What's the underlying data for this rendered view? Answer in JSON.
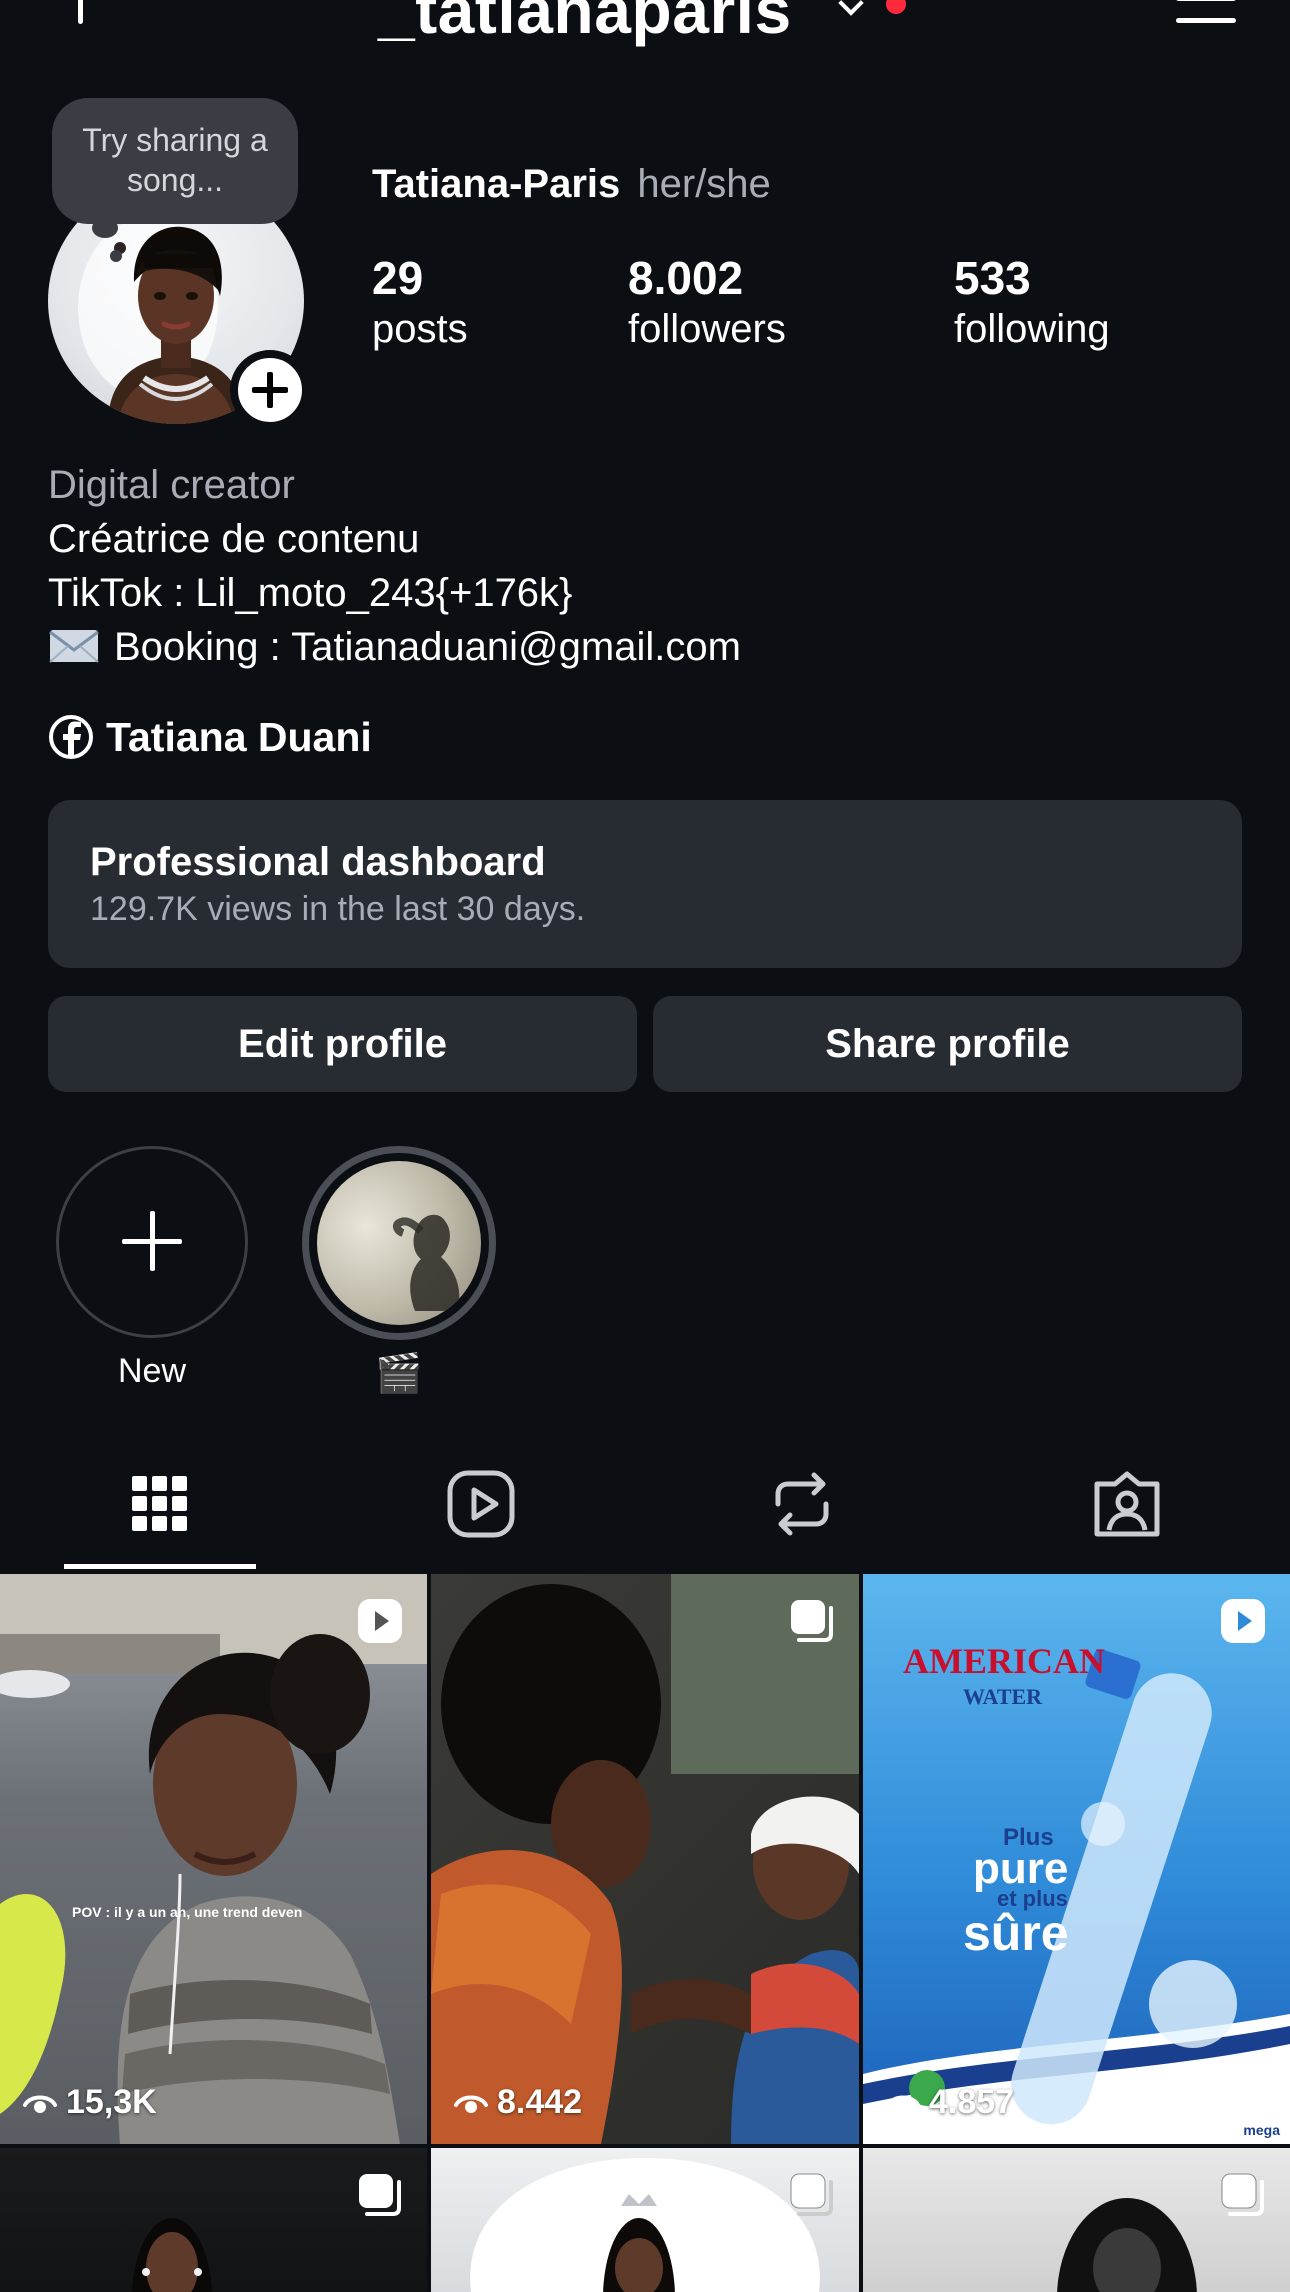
{
  "header": {
    "username": "_tatianaparis"
  },
  "profile": {
    "note_bubble": "Try sharing a song...",
    "display_name": "Tatiana-Paris",
    "pronouns": "her/she",
    "stats": [
      {
        "value": "29",
        "label": "posts"
      },
      {
        "value": "8.002",
        "label": "followers"
      },
      {
        "value": "533",
        "label": "following"
      }
    ],
    "category": "Digital creator",
    "bio_lines": [
      "Créatrice de contenu",
      "TikTok : Lil_moto_243{+176k}",
      "Booking : Tatianaduani@gmail.com"
    ],
    "facebook_link": "Tatiana Duani"
  },
  "dashboard": {
    "title": "Professional dashboard",
    "subtitle": "129.7K views in the last 30 days."
  },
  "buttons": {
    "edit": "Edit profile",
    "share": "Share profile"
  },
  "highlights": [
    {
      "label": "New"
    },
    {
      "label": "🎬"
    }
  ],
  "tabs": [
    "grid-icon",
    "reels-icon",
    "reposts-icon",
    "tagged-icon"
  ],
  "posts": [
    {
      "views": "15,3K",
      "type": "reel"
    },
    {
      "views": "8.442",
      "type": "carousel"
    },
    {
      "views": "4.857",
      "type": "reel",
      "brand": "AMERICAN",
      "brand_sub": "WATER",
      "tagline_1": "Plus",
      "tagline_2": "pure",
      "tagline_3": "et plus",
      "tagline_4": "sûre",
      "footer_logo": "mega"
    },
    {
      "views": "",
      "type": "carousel"
    },
    {
      "views": "",
      "type": "carousel"
    },
    {
      "views": "",
      "type": "carousel"
    }
  ],
  "post_caption": "POV : il y a un an, une trend deven",
  "colors": {
    "background": "#0b0f14",
    "card": "#272b32",
    "muted_text": "#a8adb5",
    "notification": "#ff2b3d"
  }
}
